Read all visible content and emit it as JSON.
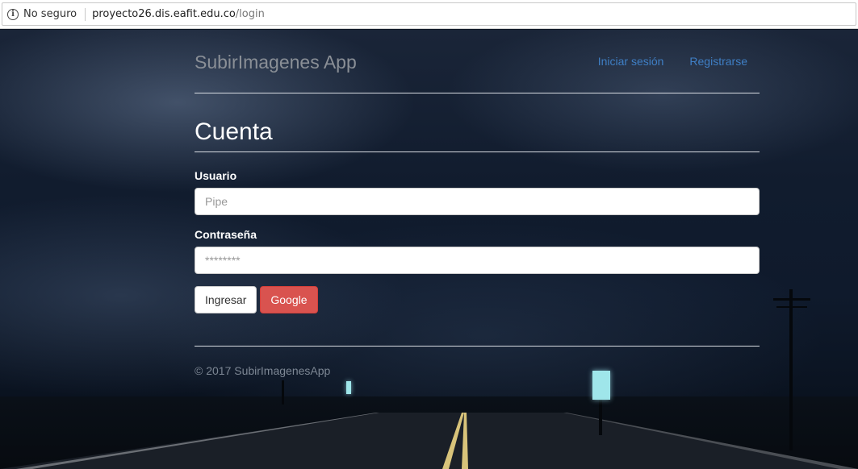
{
  "browser": {
    "security_label": "No seguro",
    "url_host": "proyecto26.dis.eafit.edu.co",
    "url_path": "/login"
  },
  "navbar": {
    "brand": "SubirImagenes App",
    "login_link": "Iniciar sesión",
    "register_link": "Registrarse"
  },
  "page": {
    "title": "Cuenta"
  },
  "form": {
    "username_label": "Usuario",
    "username_placeholder": "Pipe",
    "password_label": "Contraseña",
    "password_placeholder": "********",
    "submit_label": "Ingresar",
    "google_label": "Google"
  },
  "footer": {
    "text": "© 2017 SubirImagenesApp"
  },
  "colors": {
    "link": "#3f7fc5",
    "danger": "#d9534f"
  }
}
